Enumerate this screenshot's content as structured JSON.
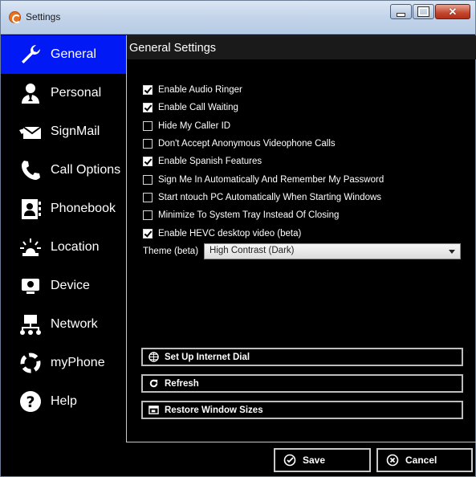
{
  "window": {
    "title": "Settings"
  },
  "sidebar": {
    "items": [
      {
        "label": "General",
        "icon": "wrench-icon",
        "active": true
      },
      {
        "label": "Personal",
        "icon": "person-icon"
      },
      {
        "label": "SignMail",
        "icon": "signmail-icon"
      },
      {
        "label": "Call Options",
        "icon": "call-options-icon"
      },
      {
        "label": "Phonebook",
        "icon": "phonebook-icon"
      },
      {
        "label": "Location",
        "icon": "location-icon"
      },
      {
        "label": "Device",
        "icon": "device-icon"
      },
      {
        "label": "Network",
        "icon": "network-icon"
      },
      {
        "label": "myPhone",
        "icon": "myphone-icon"
      },
      {
        "label": "Help",
        "icon": "help-icon"
      }
    ]
  },
  "panel": {
    "title": "General Settings",
    "options": [
      {
        "label": "Enable Audio Ringer",
        "checked": true
      },
      {
        "label": "Enable Call Waiting",
        "checked": true
      },
      {
        "label": "Hide My Caller ID",
        "checked": false
      },
      {
        "label": "Don't Accept Anonymous Videophone Calls",
        "checked": false
      },
      {
        "label": "Enable Spanish Features",
        "checked": true
      },
      {
        "label": "Sign Me In Automatically And Remember My Password",
        "checked": false
      },
      {
        "label": "Start ntouch PC Automatically When Starting Windows",
        "checked": false
      },
      {
        "label": "Minimize To System Tray Instead Of Closing",
        "checked": false
      },
      {
        "label": "Enable HEVC desktop video (beta)",
        "checked": true
      }
    ],
    "theme_label": "Theme (beta)",
    "theme_value": "High Contrast (Dark)",
    "buttons": {
      "internet_dial": "Set Up Internet Dial",
      "refresh": "Refresh",
      "restore": "Restore Window Sizes"
    }
  },
  "footer": {
    "save": "Save",
    "cancel": "Cancel"
  },
  "colors": {
    "active_nav": "#0019f5",
    "background": "#000000"
  }
}
